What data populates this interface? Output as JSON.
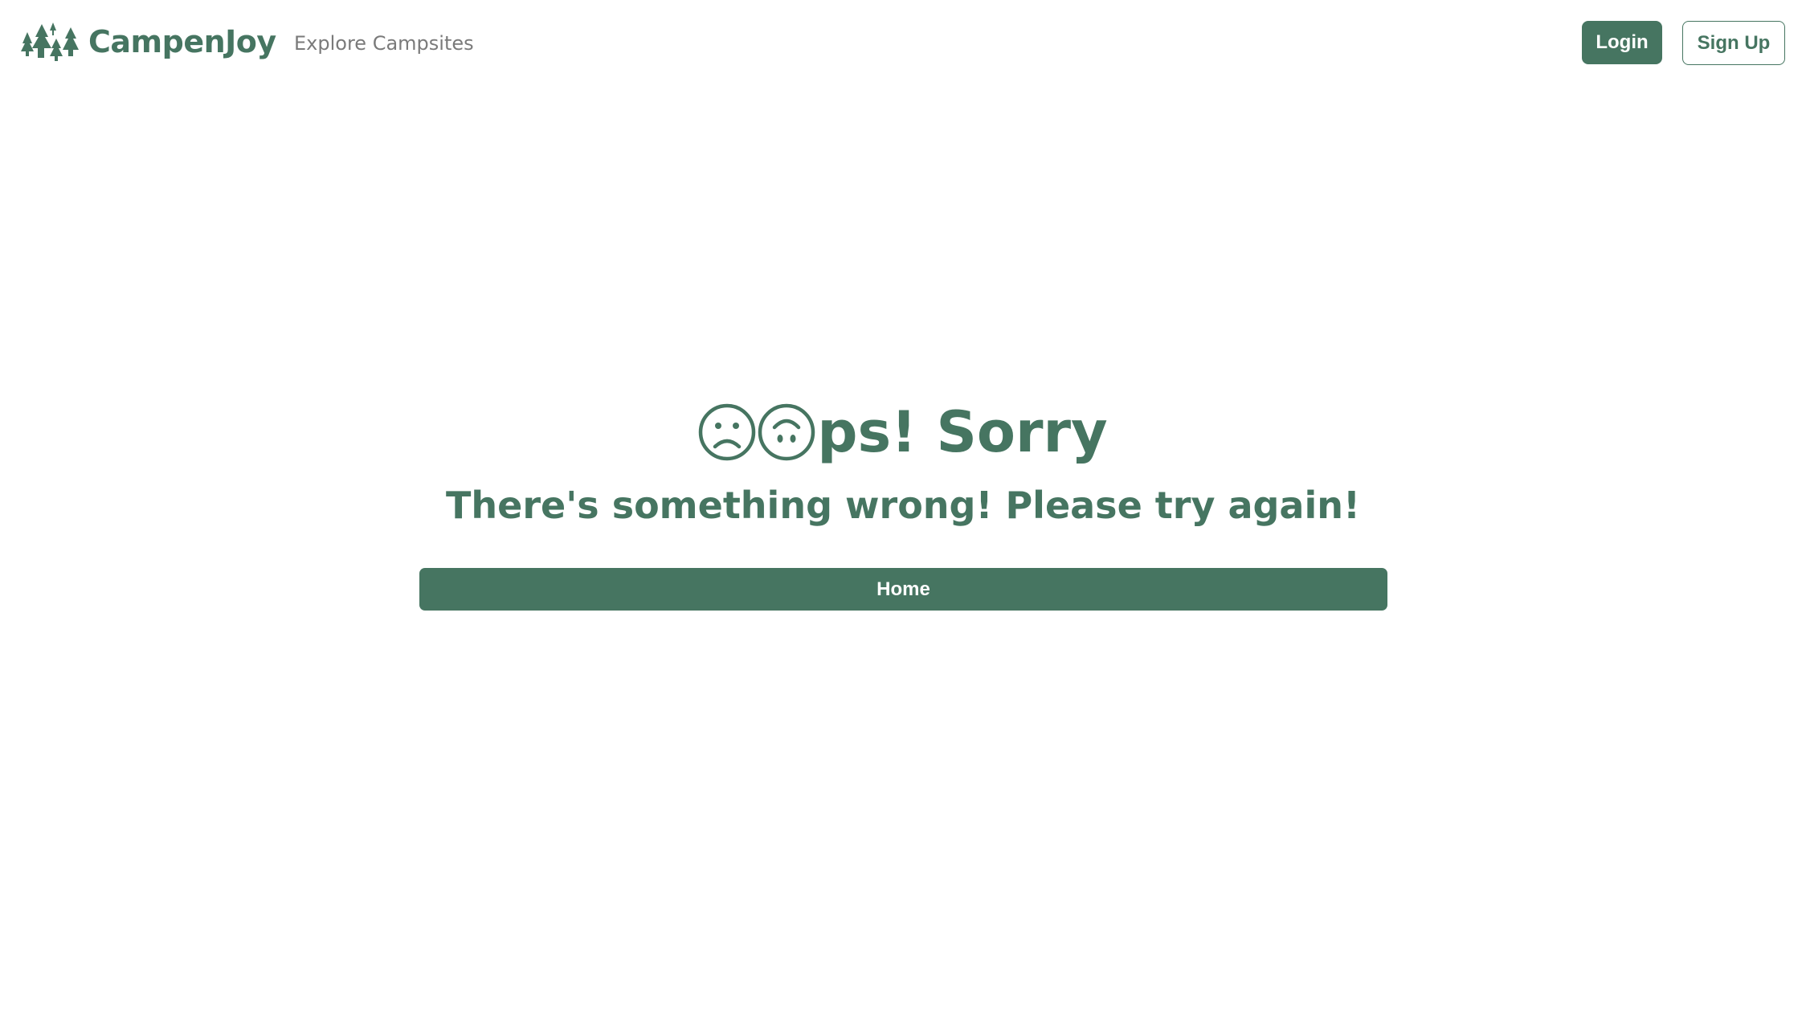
{
  "brand": {
    "name": "CampenJoy",
    "logo_icon": "pine-trees-icon",
    "color": "#467561"
  },
  "nav": {
    "explore_label": "Explore Campsites"
  },
  "auth": {
    "login_label": "Login",
    "signup_label": "Sign Up"
  },
  "error": {
    "title_text": "ps! Sorry",
    "title_icons": [
      "frowning-face-icon",
      "upside-down-face-icon"
    ],
    "subtitle": "There's something wrong! Please try again!",
    "home_label": "Home"
  },
  "colors": {
    "accent": "#467561",
    "muted_text": "#7a7a7a",
    "background": "#ffffff"
  }
}
